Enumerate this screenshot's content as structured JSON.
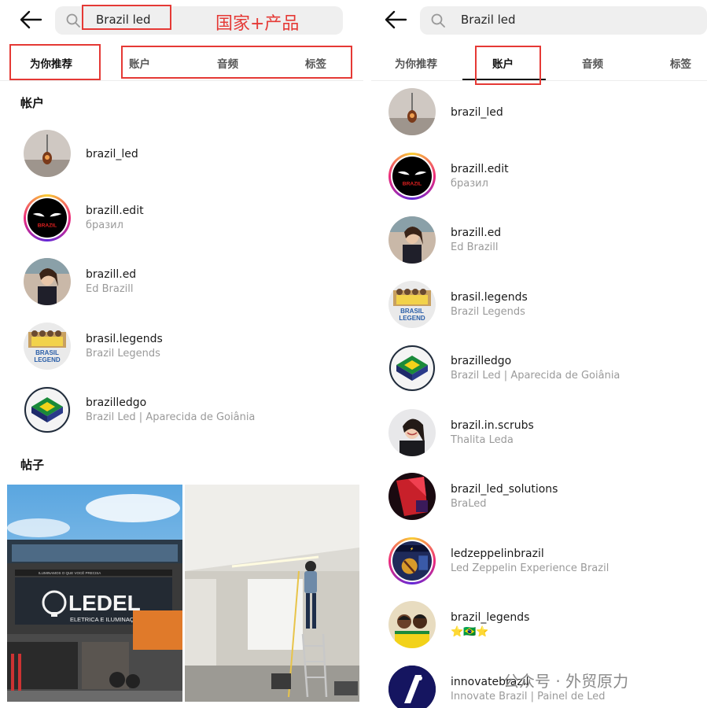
{
  "search": {
    "query": "Brazil led"
  },
  "annotation": "国家+产品",
  "tabs": [
    "为你推荐",
    "账户",
    "音频",
    "标签"
  ],
  "left": {
    "active_tab": "为你推荐",
    "accounts_heading": "帐户",
    "posts_heading": "帖子",
    "accounts": [
      {
        "username": "brazil_led",
        "fullname": ""
      },
      {
        "username": "brazill.edit",
        "fullname": "бразил"
      },
      {
        "username": "brazill.ed",
        "fullname": "Ed Brazill"
      },
      {
        "username": "brasil.legends",
        "fullname": "Brazil Legends"
      },
      {
        "username": "brazilledgo",
        "fullname": "Brazil Led | Aparecida de Goiânia"
      }
    ],
    "posts": [
      {
        "sign_main": "LEDEL",
        "sign_sub": "ELETRICA E ILUMINAÇÃO",
        "sign_top": "ILUMINAMOS O QUE VOCÊ PRECISA"
      },
      {
        "caption": ""
      }
    ]
  },
  "right": {
    "active_tab": "账户",
    "accounts": [
      {
        "username": "brazil_led",
        "fullname": ""
      },
      {
        "username": "brazill.edit",
        "fullname": "бразил"
      },
      {
        "username": "brazill.ed",
        "fullname": "Ed Brazill"
      },
      {
        "username": "brasil.legends",
        "fullname": "Brazil Legends"
      },
      {
        "username": "brazilledgo",
        "fullname": "Brazil Led | Aparecida de Goiânia"
      },
      {
        "username": "brazil.in.scrubs",
        "fullname": "Thalita Leda"
      },
      {
        "username": "brazil_led_solutions",
        "fullname": "BraLed"
      },
      {
        "username": "ledzeppelinbrazil",
        "fullname": "Led Zeppelin Experience Brazil"
      },
      {
        "username": "brazil_legends",
        "fullname": "⭐🇧🇷⭐"
      },
      {
        "username": "innovatebrazil",
        "fullname": "Innovate Brazil | Painel de Led"
      }
    ]
  },
  "avatar_labels": {
    "brasil_top": "BRASIL",
    "brasil_bottom": "LEGEND",
    "edit_text": "BRAZIL"
  },
  "watermark": "公众号 · 外贸原力",
  "colors": {
    "annotation_red": "#e53935",
    "muted_text": "#9a9a9a",
    "search_bg": "#efefef"
  }
}
